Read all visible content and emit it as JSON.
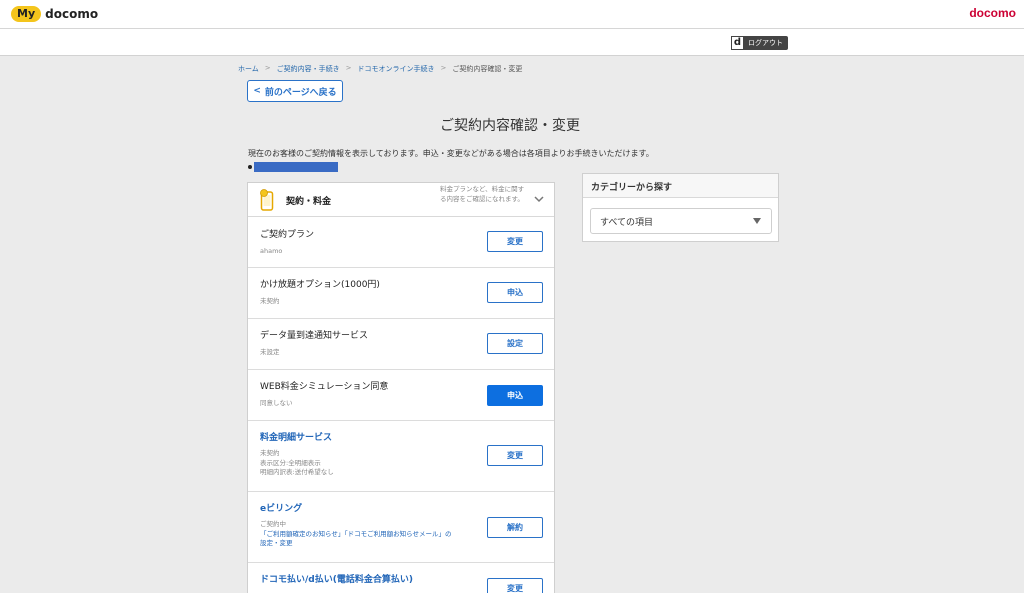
{
  "header": {
    "my_badge": "My",
    "my_text": "docomo",
    "brand": "docomo",
    "logout_icon": "d",
    "logout_label": "ログアウト"
  },
  "breadcrumb": [
    "ホーム",
    "ご契約内容・手続き",
    "ドコモオンライン手続き",
    "ご契約内容確認・変更"
  ],
  "back_button": "前のページへ戻る",
  "page_title": "ご契約内容確認・変更",
  "notice": "現在のお客様のご契約情報を表示しております。申込・変更などがある場合は各項目よりお手続きいただけます。",
  "panel": {
    "title": "契約・料金",
    "desc": "料金プランなど、料金に関する内容をご確認になれます。",
    "rows": [
      {
        "title": "ご契約プラン",
        "sub": [
          "ahamo"
        ],
        "button": "変更",
        "filled": false,
        "blue": false
      },
      {
        "title": "かけ放題オプション(1000円)",
        "sub": [
          "未契約"
        ],
        "button": "申込",
        "filled": false,
        "blue": false
      },
      {
        "title": "データ量到達通知サービス",
        "sub": [
          "未設定"
        ],
        "button": "設定",
        "filled": false,
        "blue": false
      },
      {
        "title": "WEB料金シミュレーション同意",
        "sub": [
          "同意しない"
        ],
        "button": "申込",
        "filled": true,
        "blue": false
      },
      {
        "title": "料金明細サービス",
        "sub": [
          "未契約",
          "表示区分:全明細表示",
          "明細内訳表:送付希望なし"
        ],
        "button": "変更",
        "filled": false,
        "blue": true
      },
      {
        "title": "eビリング",
        "sub": [
          "ご契約中",
          "「ご利用額確定のお知らせ」「ドコモご利用額お知らせメール」の",
          "設定・変更"
        ],
        "button": "解約",
        "filled": false,
        "blue": true
      },
      {
        "title": "ドコモ払い/d払い(電話料金合算払い)",
        "sub": [],
        "button": "変更",
        "filled": false,
        "blue": true
      }
    ]
  },
  "category": {
    "heading": "カテゴリーから探す",
    "selected": "すべての項目"
  },
  "colors": {
    "accent": "#2a72c8",
    "brand_red": "#cc0033",
    "my_yellow": "#f4c51c",
    "button_filled": "#0d6fe0"
  }
}
